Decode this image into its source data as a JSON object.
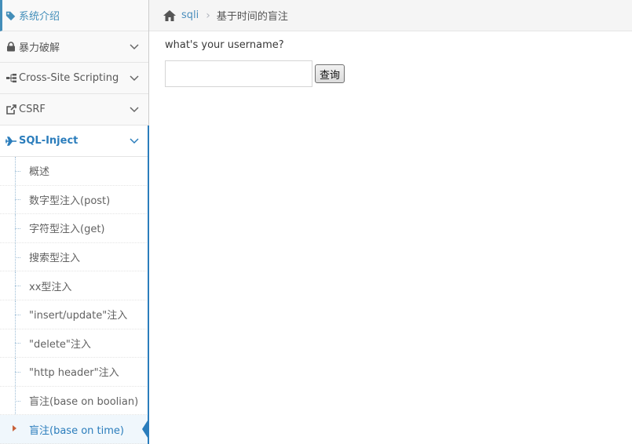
{
  "sidebar": {
    "items": [
      {
        "label": "系统介绍",
        "icon": "tags-icon"
      },
      {
        "label": "暴力破解",
        "icon": "lock-icon"
      },
      {
        "label": "Cross-Site Scripting",
        "icon": "sitemap-icon"
      },
      {
        "label": "CSRF",
        "icon": "share-square-icon"
      },
      {
        "label": "SQL-Inject",
        "icon": "plane-icon"
      }
    ],
    "submenu": [
      {
        "label": "概述"
      },
      {
        "label": "数字型注入(post)"
      },
      {
        "label": "字符型注入(get)"
      },
      {
        "label": "搜索型注入"
      },
      {
        "label": "xx型注入"
      },
      {
        "label": "\"insert/update\"注入"
      },
      {
        "label": "\"delete\"注入"
      },
      {
        "label": "\"http header\"注入"
      },
      {
        "label": "盲注(base on boolian)"
      },
      {
        "label": "盲注(base on time)"
      }
    ],
    "accent_color": "#2b7dbc"
  },
  "breadcrumb": {
    "link": "sqli",
    "current": "基于时间的盲注"
  },
  "form": {
    "question": "what's your username?",
    "input_value": "",
    "submit_label": "查询"
  }
}
